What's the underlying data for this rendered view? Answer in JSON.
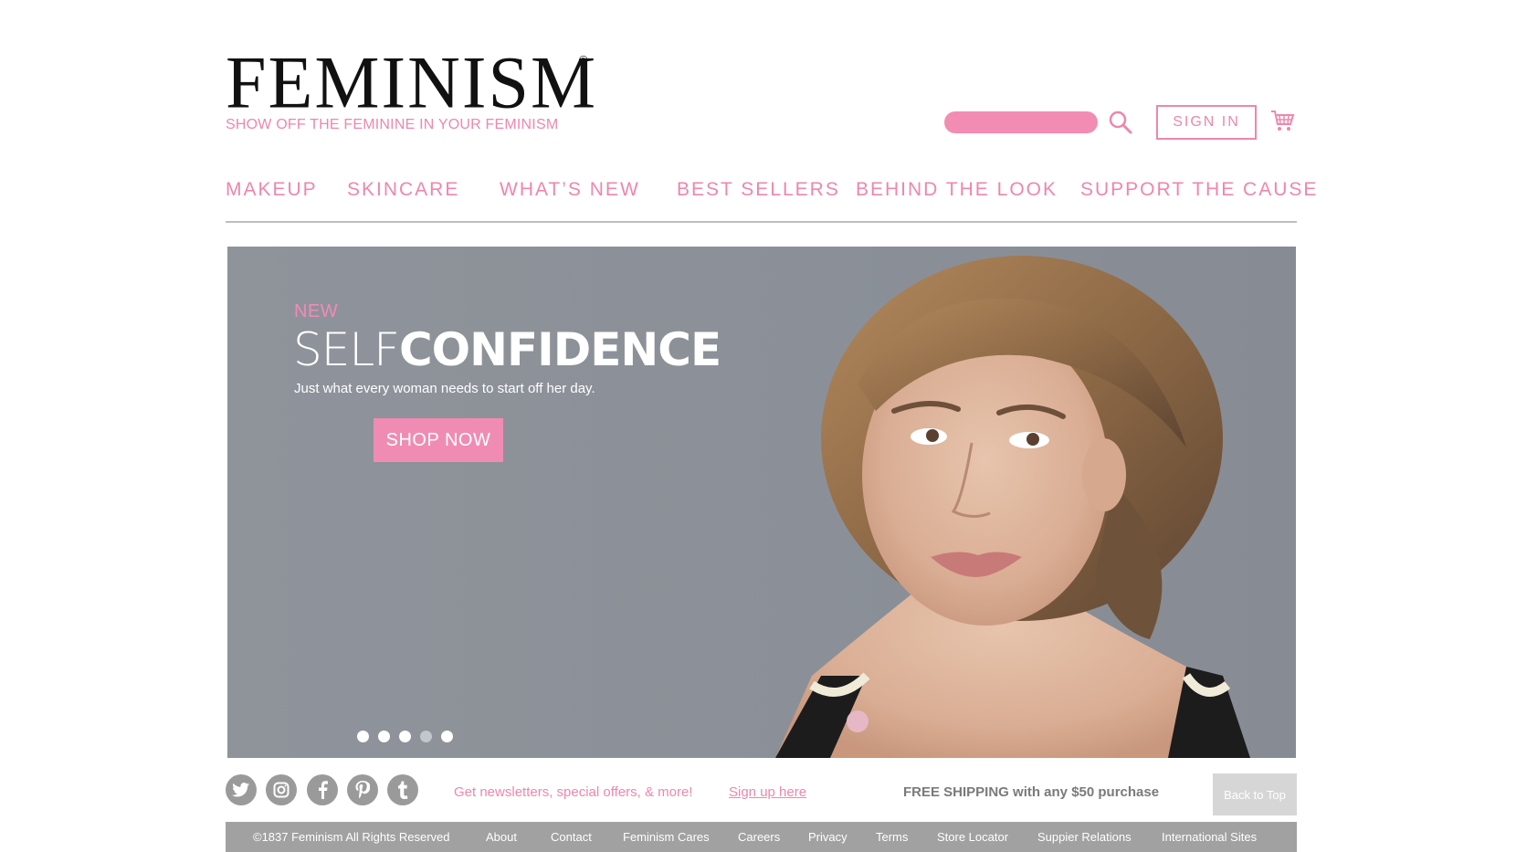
{
  "brand": {
    "name": "FEMINISM",
    "mark": "©",
    "tagline": "SHOW OFF THE FEMININE IN YOUR FEMINISM"
  },
  "header": {
    "search_value": "",
    "signin_label": "SIGN IN",
    "accent_color": "#ef86ad"
  },
  "nav": {
    "items": [
      {
        "label": "MAKEUP"
      },
      {
        "label": "SKINCARE"
      },
      {
        "label": "WHAT’S NEW"
      },
      {
        "label": "BEST SELLERS"
      },
      {
        "label": "BEHIND THE LOOK"
      },
      {
        "label": "SUPPORT THE CAUSE"
      }
    ]
  },
  "hero": {
    "badge": "NEW",
    "title_light": "SELF",
    "title_bold": "CONFIDENCE",
    "subtitle": "Just what every woman needs to start off her day.",
    "cta": "SHOP NOW",
    "slides_total": 5,
    "active_slide": 4
  },
  "social": {
    "icons": [
      "twitter-icon",
      "instagram-icon",
      "facebook-icon",
      "pinterest-icon",
      "tumblr-icon"
    ]
  },
  "promo": {
    "newsletter_text": "Get newsletters, special offers, & more!",
    "signup_link": "Sign up here",
    "shipping_text": "FREE SHIPPING with any $50 purchase",
    "back_to_top": "Back to Top"
  },
  "footer": {
    "copyright": "©1837 Feminism All Rights Reserved",
    "links": [
      "About",
      "Contact",
      "Feminism Cares",
      "Careers",
      "Privacy",
      "Terms",
      "Store Locator",
      "Suppier Relations",
      "International Sites"
    ]
  }
}
